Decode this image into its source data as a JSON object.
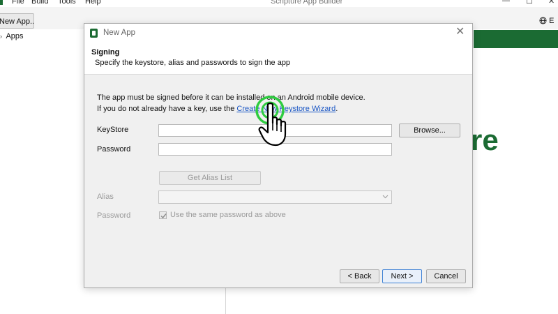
{
  "app": {
    "window_title": "Scripture App Builder",
    "menu": [
      "File",
      "Build",
      "Tools",
      "Help"
    ],
    "toolbar": {
      "new_app_label": "New App...",
      "lang_label": "E"
    },
    "sidebar": {
      "tree_root": "Apps"
    },
    "background_text": "re",
    "colors": {
      "brand": "#1b6b33",
      "link": "#1a56c4",
      "cursor_ring": "#2ecc40"
    }
  },
  "dialog": {
    "title": "New App",
    "heading": "Signing",
    "subheading": "Specify the keystore, alias and passwords to sign the app",
    "info_line1": "The app must be signed before it can be installed on an Android mobile device.",
    "info_line2_prefix": "If you do not already have a key, use the ",
    "wizard_link": "Create New Keystore Wizard",
    "info_line2_suffix": ".",
    "keystore": {
      "label": "KeyStore",
      "value": "",
      "browse_label": "Browse..."
    },
    "password": {
      "label": "Password",
      "value": ""
    },
    "get_alias_label": "Get Alias List",
    "alias": {
      "label": "Alias",
      "value": ""
    },
    "alias_password": {
      "label": "Password",
      "checkbox_label": "Use the same password as above",
      "checked": true
    },
    "buttons": {
      "back": "< Back",
      "next": "Next >",
      "cancel": "Cancel"
    }
  },
  "icons": {
    "app": "app-icon",
    "globe": "globe-icon",
    "close": "close-icon",
    "chevron": "chevron-down-icon",
    "check": "check-icon",
    "cursor": "hand-cursor-icon",
    "click": "click-indicator-icon"
  }
}
